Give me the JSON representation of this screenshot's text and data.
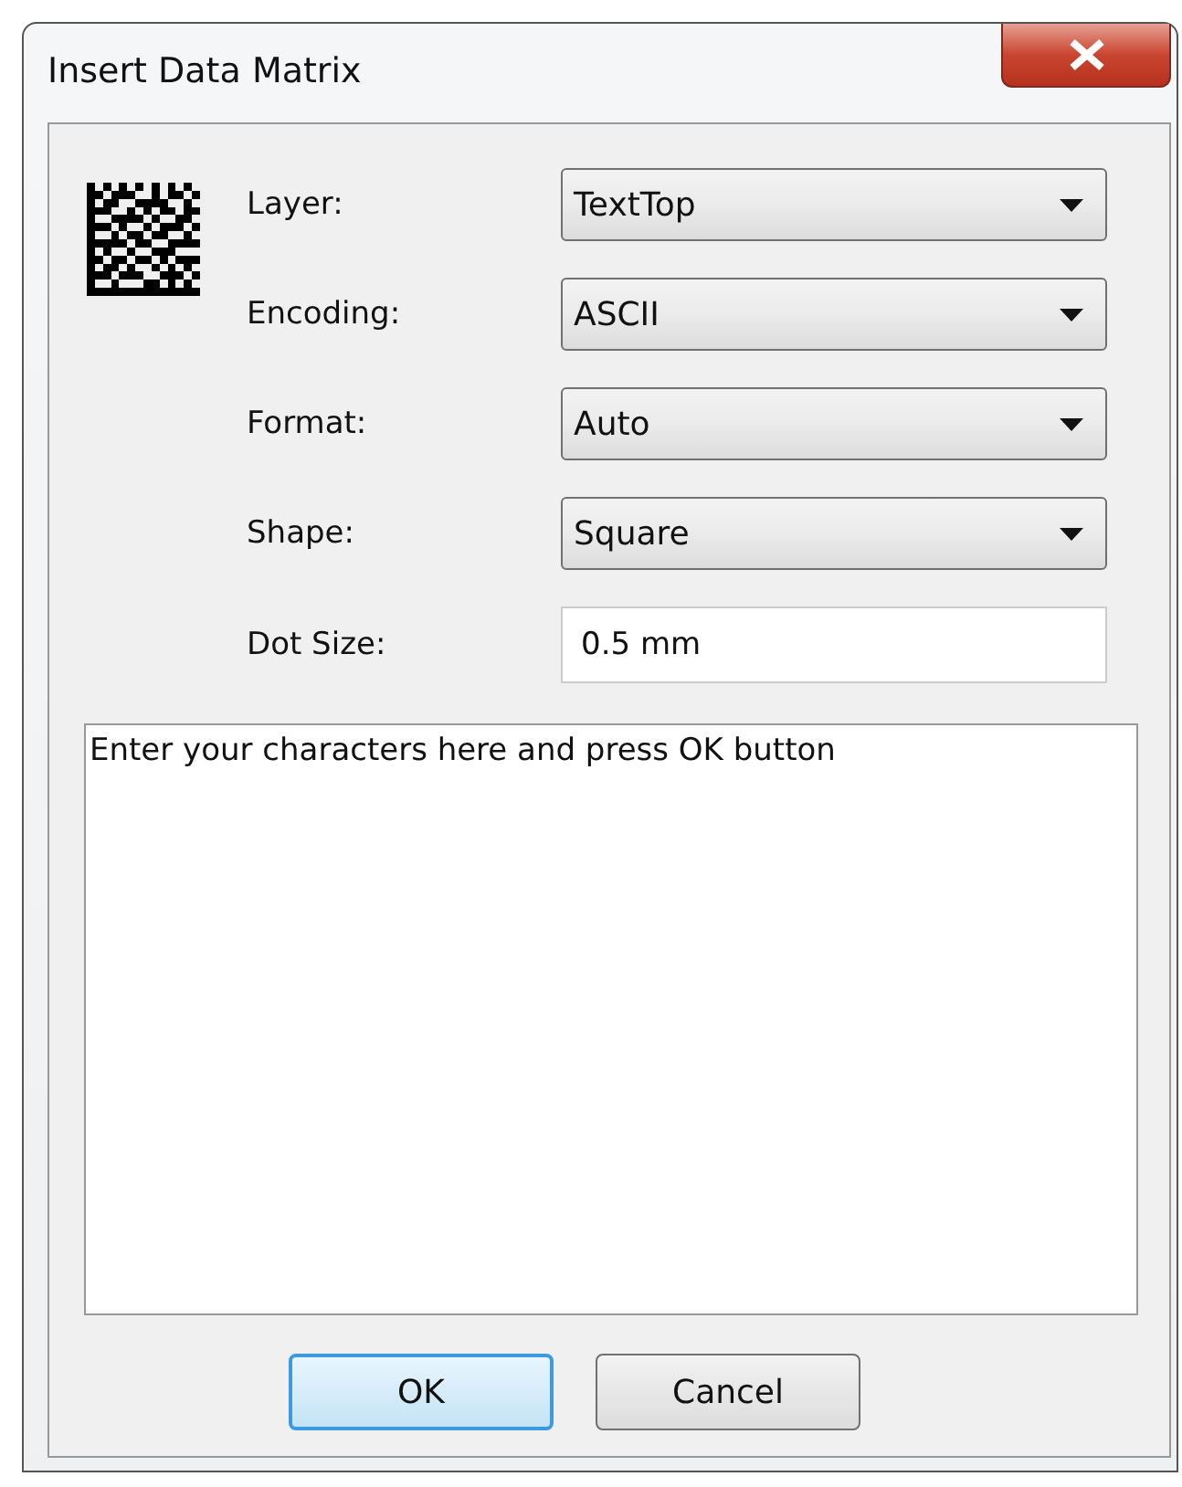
{
  "window": {
    "title": "Insert Data Matrix"
  },
  "fields": [
    {
      "kind": "dropdown",
      "label": "Layer:",
      "value": "TextTop"
    },
    {
      "kind": "dropdown",
      "label": "Encoding:",
      "value": "ASCII"
    },
    {
      "kind": "dropdown",
      "label": "Format:",
      "value": "Auto"
    },
    {
      "kind": "dropdown",
      "label": "Shape:",
      "value": "Square"
    },
    {
      "kind": "text",
      "label": "Dot Size:",
      "value": "0.5 mm"
    }
  ],
  "text_area": {
    "value": "Enter your characters here and press OK button"
  },
  "buttons": [
    {
      "label": "OK",
      "default": true
    },
    {
      "label": "Cancel",
      "default": false
    }
  ]
}
